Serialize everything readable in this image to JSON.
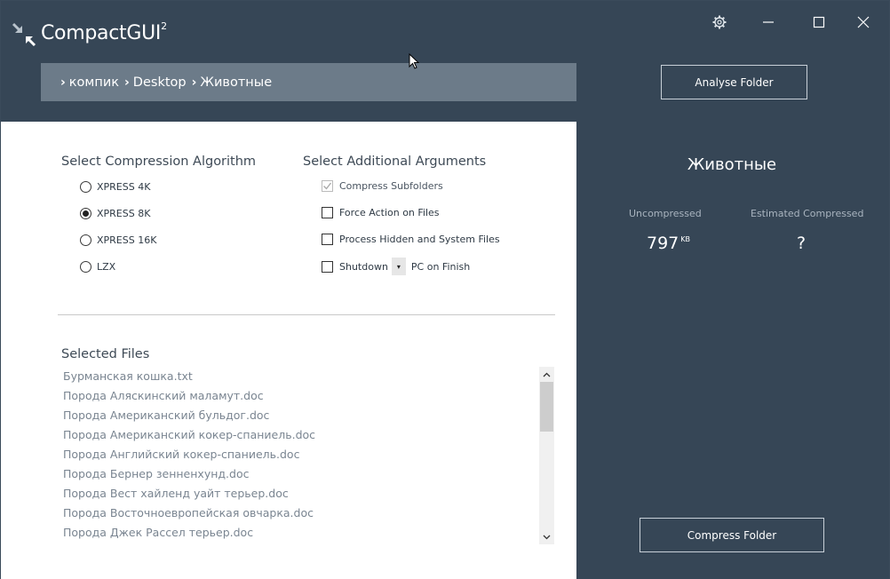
{
  "app": {
    "title": "CompactGUI",
    "title_sup": "2"
  },
  "breadcrumb": [
    {
      "label": "компик"
    },
    {
      "label": "Desktop"
    },
    {
      "label": "Животные"
    }
  ],
  "header": {
    "analyse_label": "Analyse Folder"
  },
  "algorithm": {
    "title": "Select Compression Algorithm",
    "options": [
      {
        "label": "XPRESS 4K",
        "selected": false
      },
      {
        "label": "XPRESS 8K",
        "selected": true
      },
      {
        "label": "XPRESS 16K",
        "selected": false
      },
      {
        "label": "LZX",
        "selected": false
      }
    ]
  },
  "arguments": {
    "title": "Select Additional Arguments",
    "compress_subfolders": "Compress Subfolders",
    "force_action": "Force Action on Files",
    "process_hidden": "Process Hidden and System Files",
    "shutdown": "Shutdown",
    "shutdown_suffix": "PC on Finish"
  },
  "files": {
    "title": "Selected Files",
    "items": [
      "Бурманская кошка.txt",
      "Порода Аляскинский маламут.doc",
      "Порода Американский бульдог.doc",
      "Порода Американский кокер-спаниель.doc",
      "Порода Английский кокер-спаниель.doc",
      "Порода Бернер зенненхунд.doc",
      "Порода Вест хайленд уайт терьер.doc",
      "Порода Восточноевропейская овчарка.doc",
      "Порода Джек Рассел терьер.doc"
    ]
  },
  "side": {
    "folder_name": "Животные",
    "uncompressed_label": "Uncompressed",
    "uncompressed_value": "797",
    "uncompressed_unit": "KB",
    "estimated_label": "Estimated Compressed",
    "estimated_value": "?",
    "compress_label": "Compress Folder"
  },
  "icons": {
    "settings": "gear-icon",
    "minimize": "minimize-icon",
    "maximize": "maximize-icon",
    "close": "close-icon",
    "logo": "compress-arrows-icon"
  },
  "colors": {
    "header_bg": "#364656",
    "breadcrumb_bg": "#6c7b89",
    "side_bg": "#364656"
  }
}
